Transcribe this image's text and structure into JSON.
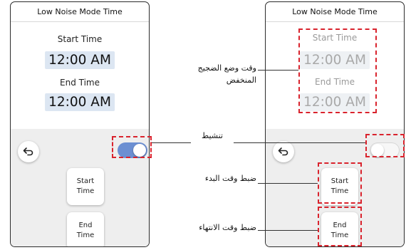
{
  "left_panel": {
    "title": "Low Noise Mode Time",
    "start_label": "Start Time",
    "start_value": "12:00 AM",
    "end_label": "End Time",
    "end_value": "12:00 AM",
    "toggle_state": "on",
    "start_button": [
      "Start",
      "Time"
    ],
    "end_button": [
      "End",
      "Time"
    ]
  },
  "right_panel": {
    "title": "Low Noise Mode Time",
    "start_label": "Start Time",
    "start_value": "12:00 AM",
    "end_label": "End Time",
    "end_value": "12:00 AM",
    "toggle_state": "off",
    "start_button": [
      "Start",
      "Time"
    ],
    "end_button": [
      "End",
      "Time"
    ]
  },
  "annotations": {
    "low_noise_time": [
      "وقت وضع الضجيج",
      "المنخفض"
    ],
    "activate": "تنشيط",
    "set_start": "ضبط وقت البدء",
    "set_end": "ضبط وقت الانتهاء"
  },
  "colors": {
    "toggle_on": "#6c8fd2",
    "highlight_dash": "#d9232d",
    "time_bg": "#dce6f2"
  },
  "icons": {
    "back": "back-arrow-icon"
  }
}
